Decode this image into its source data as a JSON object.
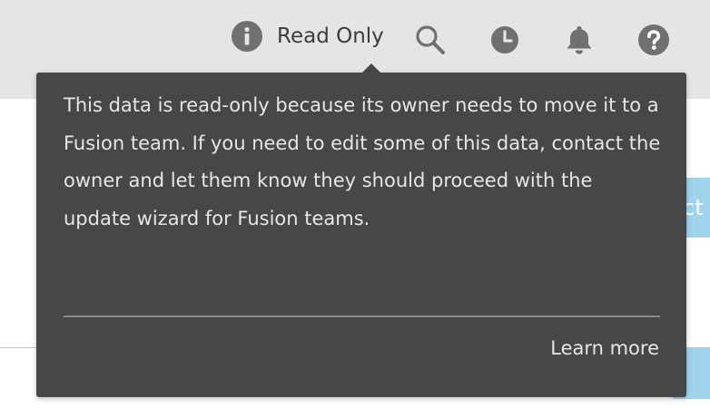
{
  "header": {
    "status_label": "Read Only",
    "icons": [
      "info-icon",
      "search-icon",
      "clock-icon",
      "bell-icon",
      "help-icon"
    ]
  },
  "background": {
    "side_button_label": "ct"
  },
  "tooltip": {
    "message": "This data is read-only because its owner needs to move it to a Fusion team. If you need to edit some of this data, contact the owner and let them know they should proceed with the update wizard for Fusion teams.",
    "link_label": "Learn more"
  },
  "colors": {
    "header_bg": "#e5e5e5",
    "tooltip_bg": "#474747",
    "tooltip_text": "#e6e6e6",
    "icon_gray": "#707070",
    "accent_light_blue": "#9fd4ec"
  }
}
